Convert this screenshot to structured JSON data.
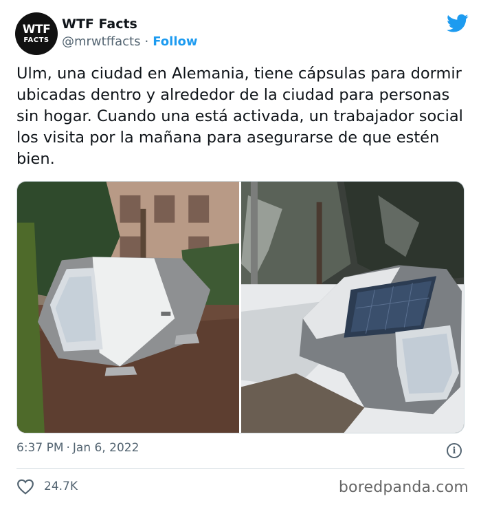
{
  "author": {
    "avatar_line1": "WTF",
    "avatar_line2": "FACTS",
    "name": "WTF Facts",
    "handle": "@mrwtffacts",
    "separator": "·",
    "follow_label": "Follow"
  },
  "tweet": {
    "text": "Ulm, una ciudad en Alemania, tiene cápsulas para dormir ubicadas dentro y alrededor de la ciudad para personas sin hogar. Cuando una está activada, un trabajador social los visita por la mañana para asegurarse de que estén bien.",
    "time": "6:37 PM",
    "date": "Jan 6, 2022",
    "meta_separator": "·",
    "likes": "24.7K"
  },
  "media": {
    "photos": [
      {
        "description_icon": "sleeping-pod-autumn"
      },
      {
        "description_icon": "sleeping-pod-snow"
      }
    ]
  },
  "icons": {
    "brand": "twitter-bird-icon",
    "info": "info-icon",
    "like": "heart-icon"
  },
  "colors": {
    "accent": "#1d9bf0",
    "text": "#0f1419",
    "secondary": "#536471",
    "border": "#cfd9de"
  },
  "watermark": "boredpanda.com"
}
